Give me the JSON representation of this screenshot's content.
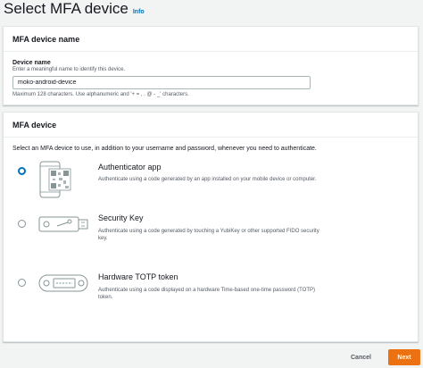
{
  "page": {
    "title": "Select MFA device",
    "info_link": "Info"
  },
  "name_section": {
    "heading": "MFA device name",
    "label": "Device name",
    "description": "Enter a meaningful name to identify this device.",
    "value": "moko-android-device",
    "constraint": "Maximum 128 characters. Use alphanumeric and '+ = , . @ - _' characters."
  },
  "device_section": {
    "heading": "MFA device",
    "intro": "Select an MFA device to use, in addition to your username and password, whenever you need to authenticate.",
    "options": [
      {
        "title": "Authenticator app",
        "description": "Authenticate using a code generated by an app installed on your mobile device or computer.",
        "selected": true,
        "icon": "authenticator-app-illustration"
      },
      {
        "title": "Security Key",
        "description": "Authenticate using a code generated by touching a YubiKey or other supported FIDO security key.",
        "selected": false,
        "icon": "security-key-illustration"
      },
      {
        "title": "Hardware TOTP token",
        "description": "Authenticate using a code displayed on a hardware Time-based one-time password (TOTP) token.",
        "selected": false,
        "icon": "hardware-token-illustration"
      }
    ]
  },
  "actions": {
    "cancel_label": "Cancel",
    "next_label": "Next"
  },
  "colors": {
    "accent": "#0073bb",
    "primary_button": "#ec7211",
    "background": "#f2f3f3"
  }
}
